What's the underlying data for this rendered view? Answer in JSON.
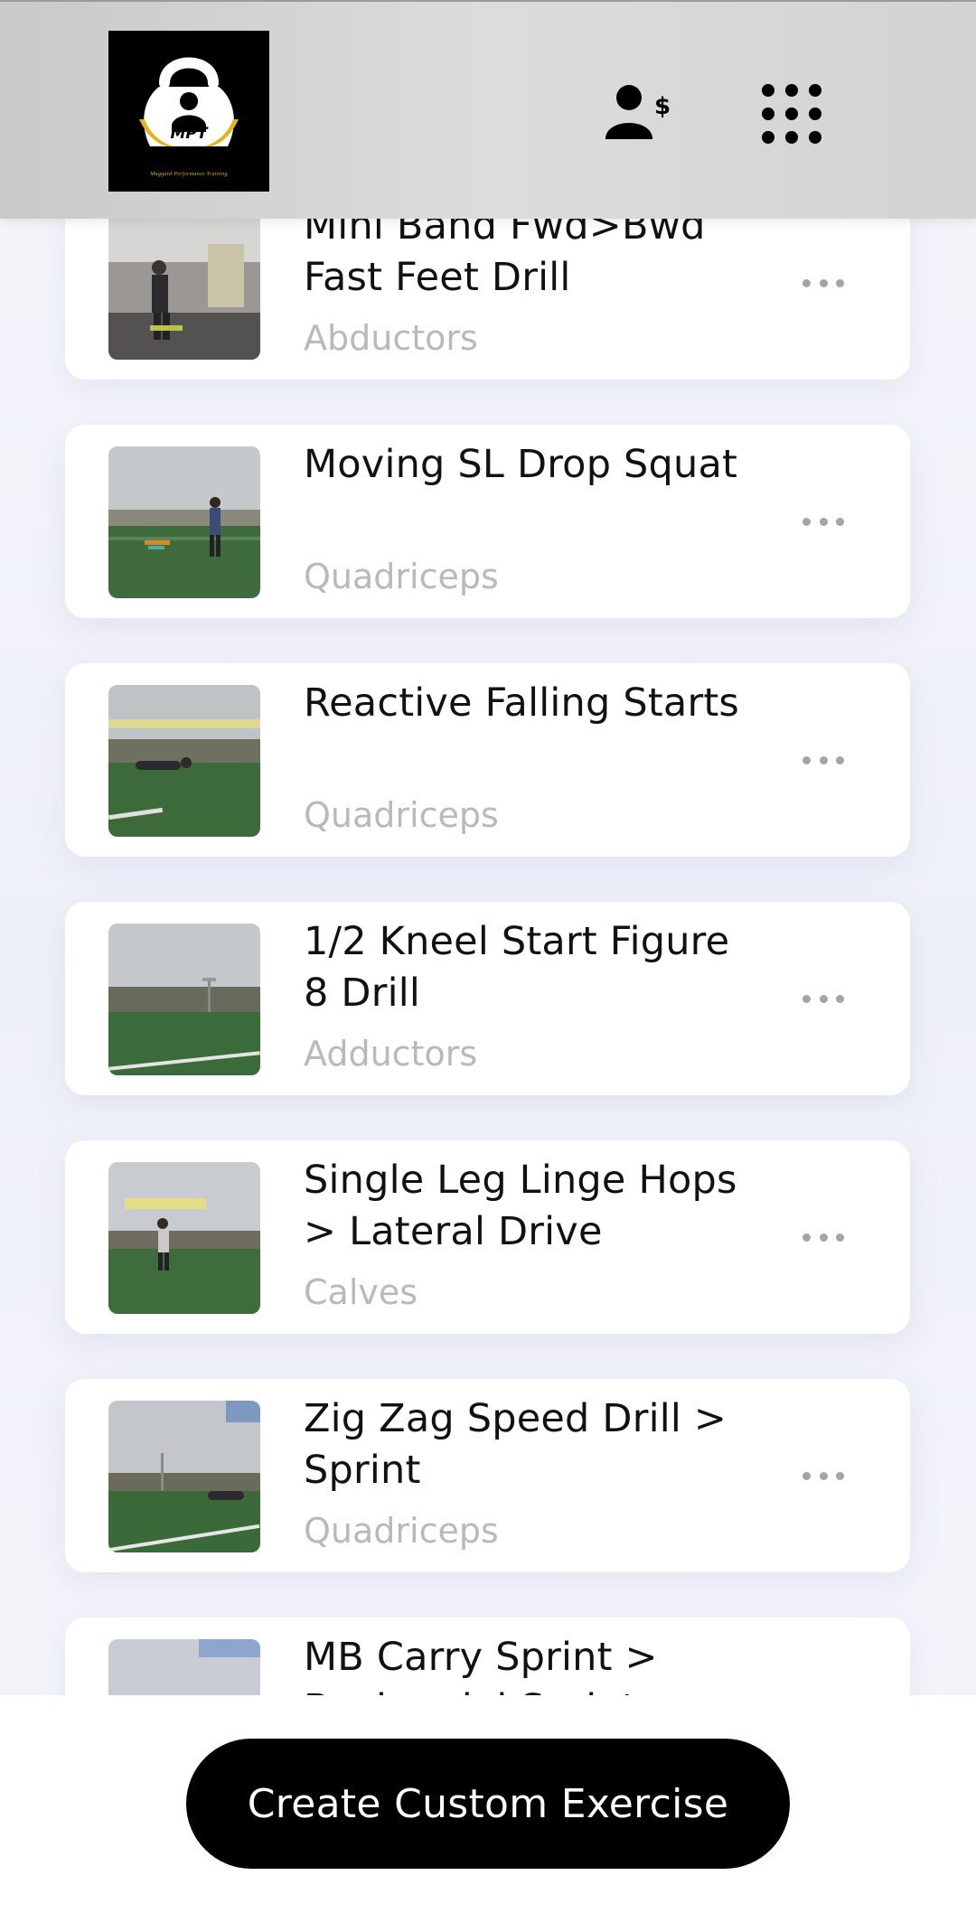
{
  "header": {
    "logo_text": "MPT",
    "logo_tagline": "Maggard Performance Training",
    "billing_icon": "user-dollar-icon",
    "menu_icon": "grid-menu-icon"
  },
  "exercises": [
    {
      "title": "Mini Band Fwd>Bwd Fast Feet Drill",
      "muscle": "Abductors",
      "scene": "gym"
    },
    {
      "title": "Moving SL Drop Squat",
      "muscle": "Quadriceps",
      "scene": "field"
    },
    {
      "title": "Reactive Falling Starts",
      "muscle": "Quadriceps",
      "scene": "field-caption"
    },
    {
      "title": "1/2 Kneel Start Figure 8 Drill",
      "muscle": "Adductors",
      "scene": "field-pole"
    },
    {
      "title": "Single Leg Linge Hops > Lateral Drive",
      "muscle": "Calves",
      "scene": "field-caption2"
    },
    {
      "title": "Zig Zag Speed Drill > Sprint",
      "muscle": "Quadriceps",
      "scene": "field-pole2"
    },
    {
      "title": "MB Carry Sprint > Backpedal Sprint",
      "muscle": "",
      "scene": "sky"
    }
  ],
  "more_icon": "ellipsis-icon",
  "footer": {
    "create_button_label": "Create Custom Exercise"
  },
  "colors": {
    "accent": "#000000",
    "subtitle": "#b9b9bc",
    "logo_gold": "#e2b41b"
  }
}
